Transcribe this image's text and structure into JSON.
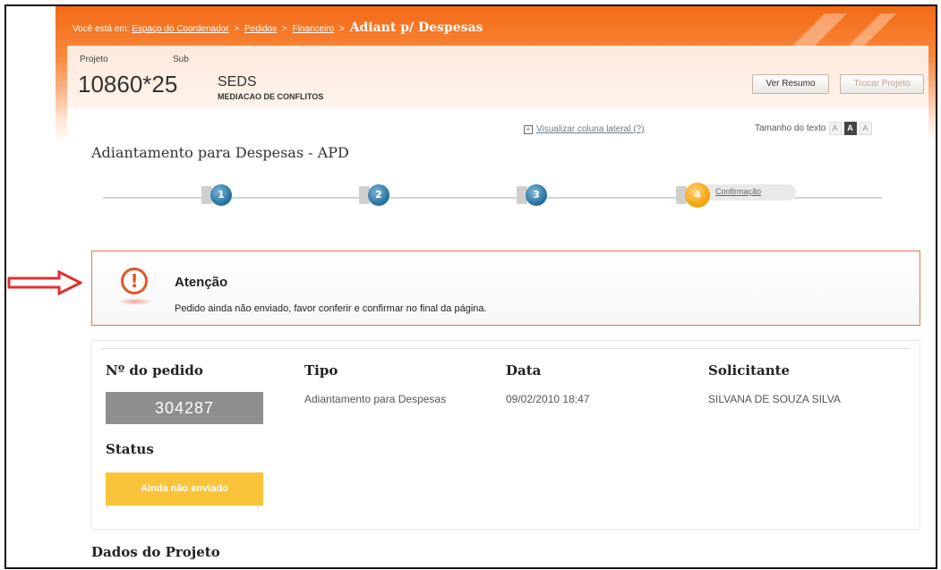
{
  "breadcrumb": {
    "prefix": "Você está em:",
    "items": [
      "Espaço do Coordenador",
      "Pedidos",
      "Financeiro"
    ],
    "separator": ">",
    "current": "Adiant p/ Despesas"
  },
  "project": {
    "label_project": "Projeto",
    "label_sub": "Sub",
    "number": "10860*25",
    "sub_name": "SEDS",
    "sub_desc": "MEDIACAO DE CONFLITOS",
    "btn_resumo": "Ver Resumo",
    "btn_trocar": "Trocar Projeto"
  },
  "toolbar": {
    "lateral": "Visualizar coluna lateral (?)",
    "text_size_label": "Tamanho do texto",
    "sizes": [
      "A",
      "A",
      "A"
    ]
  },
  "page_title": "Adiantamento para Despesas - APD",
  "steps": [
    {
      "num": "1"
    },
    {
      "num": "2"
    },
    {
      "num": "3"
    },
    {
      "num": "4",
      "label": "Confirmação"
    }
  ],
  "alert": {
    "title": "Atenção",
    "message": "Pedido ainda não enviado, favor conferir e confirmar no final da página.",
    "icon": "exclamation-icon"
  },
  "order": {
    "headers": {
      "pedido": "Nº do pedido",
      "tipo": "Tipo",
      "data": "Data",
      "solicitante": "Solicitante"
    },
    "pedido_number": "304287",
    "tipo": "Adiantamento para Despesas",
    "data": "09/02/2010 18:47",
    "solicitante": "SILVANA DE SOUZA SILVA",
    "status_label": "Status",
    "status_value": "Ainda não enviado"
  },
  "section_next": "Dados do Projeto",
  "colors": {
    "accent": "#f26a16",
    "status": "#f9c33a",
    "step": "#1f6d9c",
    "step_active": "#f2a000",
    "arrow": "#e03030"
  }
}
